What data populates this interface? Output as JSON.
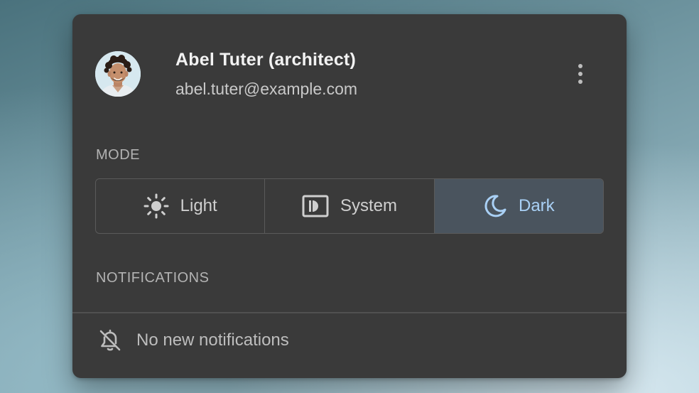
{
  "user": {
    "name": "Abel Tuter (architect)",
    "email": "abel.tuter@example.com",
    "avatar_icon": "user-avatar-photo"
  },
  "menu": {
    "more_icon": "more-vertical-icon"
  },
  "mode": {
    "label": "MODE",
    "selected": "Dark",
    "options": [
      {
        "label": "Light",
        "icon": "sun-icon"
      },
      {
        "label": "System",
        "icon": "system-display-icon"
      },
      {
        "label": "Dark",
        "icon": "moon-icon"
      }
    ]
  },
  "notifications": {
    "label": "NOTIFICATIONS",
    "empty_text": "No new notifications",
    "empty_icon": "bell-off-icon"
  },
  "colors": {
    "panel_bg": "#3a3a3a",
    "selected_bg": "#4a545e",
    "selected_text": "#a9d0f5"
  }
}
